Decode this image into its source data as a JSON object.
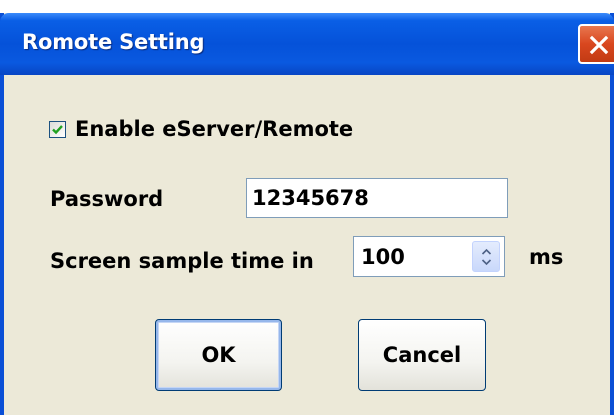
{
  "window": {
    "title": "Romote Setting",
    "close_icon": "close-icon"
  },
  "enable": {
    "label": "Enable eServer/Remote",
    "checked": true
  },
  "password": {
    "label": "Password",
    "value": "12345678"
  },
  "sample_time": {
    "label": "Screen sample time in",
    "value": "100",
    "unit": "ms"
  },
  "buttons": {
    "ok_label": "OK",
    "cancel_label": "Cancel"
  },
  "colors": {
    "titlebar": "#0552d9",
    "close_button": "#d9471f",
    "dialog_face": "#ece9d8",
    "checkmark": "#21a121"
  }
}
